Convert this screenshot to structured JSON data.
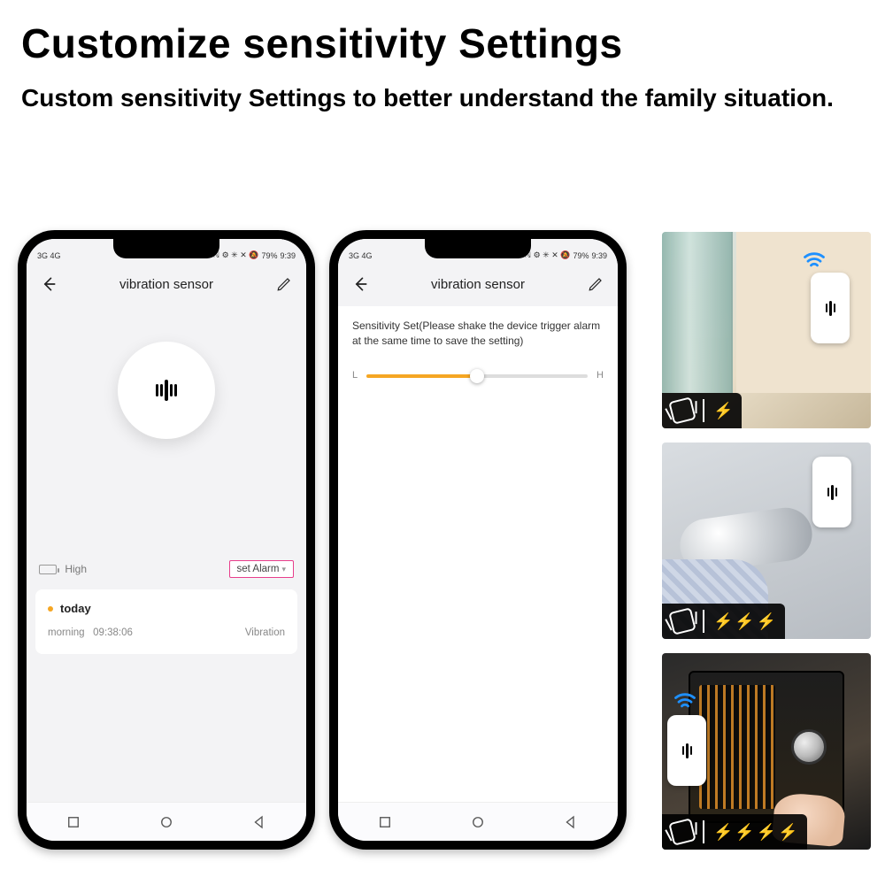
{
  "heading": "Customize sensitivity Settings",
  "subheading": "Custom sensitivity Settings to better understand the family situation.",
  "status": {
    "network": "3G 4G",
    "wifi": "wifi",
    "right_icons": "ℕ ⚙ ✳ ✕ 🔕",
    "battery_pct": "79%",
    "time": "9:39"
  },
  "app": {
    "title": "vibration sensor",
    "battery_level": "High",
    "set_alarm": "set Alarm",
    "today_label": "today",
    "log_time_prefix": "morning",
    "log_time": "09:38:06",
    "log_event": "Vibration"
  },
  "sensitivity": {
    "instruction": "Sensitivity Set(Please shake the device trigger alarm at the same time to save the setting)",
    "low_label": "L",
    "high_label": "H",
    "value_pct": 50
  },
  "scenes": [
    {
      "bolts": 1
    },
    {
      "bolts": 3
    },
    {
      "bolts": 4
    }
  ]
}
